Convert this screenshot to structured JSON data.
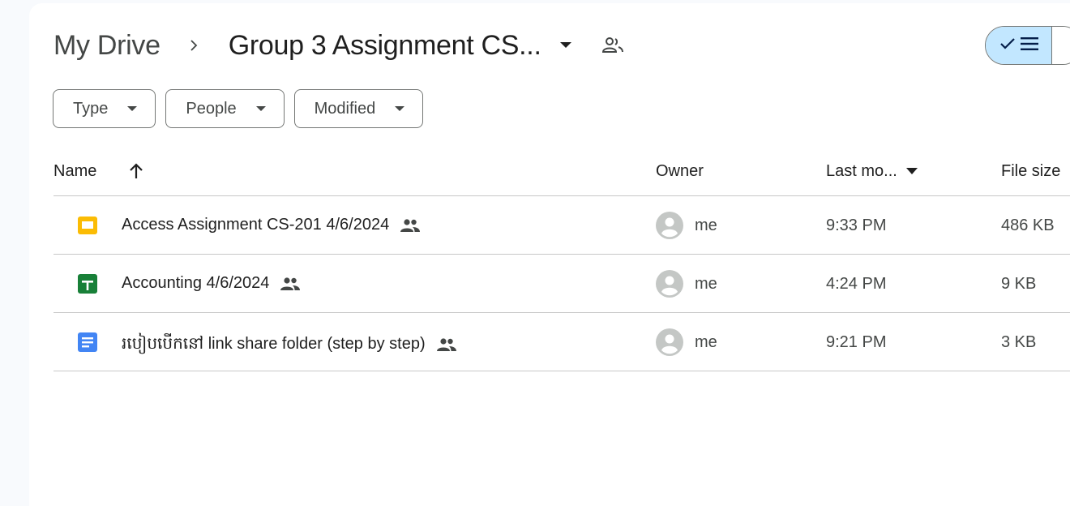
{
  "breadcrumb": {
    "root": "My Drive",
    "current": "Group 3 Assignment CS..."
  },
  "filters": [
    {
      "label": "Type"
    },
    {
      "label": "People"
    },
    {
      "label": "Modified"
    }
  ],
  "columns": {
    "name": "Name",
    "owner": "Owner",
    "modified": "Last mo...",
    "size": "File size"
  },
  "files": [
    {
      "name": "Access Assignment CS-201 4/6/2024",
      "type_icon": "slides-icon",
      "icon_color": "#fbbc04",
      "owner": "me",
      "modified": "9:33 PM",
      "size": "486 KB"
    },
    {
      "name": "Accounting 4/6/2024",
      "type_icon": "sheets-icon",
      "icon_color": "#188038",
      "owner": "me",
      "modified": "4:24 PM",
      "size": "9 KB"
    },
    {
      "name": "របៀបបើកនៅ link share folder (step by step)",
      "type_icon": "docs-icon",
      "icon_color": "#4285f4",
      "owner": "me",
      "modified": "9:21 PM",
      "size": "3 KB"
    }
  ],
  "colors": {
    "selected_view": "#c2e7ff",
    "border": "#747775",
    "divider": "#c7c7c7"
  }
}
